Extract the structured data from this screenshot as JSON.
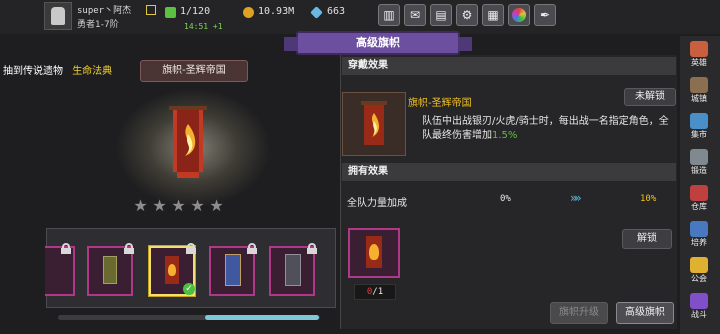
{
  "header": {
    "username": "super丶阿杰",
    "rank": "勇者1-7阶",
    "stamina": "1/120",
    "timer": "14:51 +1",
    "gold": "10.93M",
    "gems": "663"
  },
  "title": "高级旗帜",
  "left": {
    "tab_legendary": "抽到传说遗物",
    "tab_codex": "生命法典",
    "banner_name": "旗帜-圣辉帝国",
    "stars": [
      "★",
      "★",
      "★",
      "★",
      "★"
    ],
    "star_count": 0
  },
  "right": {
    "wear_header": "穿戴效果",
    "effect_name": "旗帜-圣辉帝国",
    "unlock_state": "未解锁",
    "desc_main": "队伍中出战银刃/火虎/骑士时，每出战一名指定角色，全队最终伤害增加",
    "desc_pct": "1.5%",
    "own_header": "拥有效果",
    "stat_label": "全队力量加成",
    "stat_current": "0%",
    "stat_arrow": "»»",
    "stat_next": "10%",
    "own_current": "0",
    "own_total": "/1",
    "unlock_button": "解锁",
    "upgrade_button": "旗帜升级",
    "advanced_button": "高级旗帜"
  },
  "sidenav": [
    {
      "label": "英雄",
      "icon": "hero-icon",
      "color": "#c86040"
    },
    {
      "label": "城镇",
      "icon": "town-icon",
      "color": "#8a7050"
    },
    {
      "label": "集市",
      "icon": "market-icon",
      "color": "#4a90c8"
    },
    {
      "label": "锻造",
      "icon": "forge-icon",
      "color": "#808890"
    },
    {
      "label": "仓库",
      "icon": "warehouse-icon",
      "color": "#c04040"
    },
    {
      "label": "培养",
      "icon": "train-icon",
      "color": "#4878c0"
    },
    {
      "label": "公会",
      "icon": "guild-icon",
      "color": "#e0b030"
    },
    {
      "label": "战斗",
      "icon": "battle-icon",
      "color": "#8050c8"
    }
  ]
}
